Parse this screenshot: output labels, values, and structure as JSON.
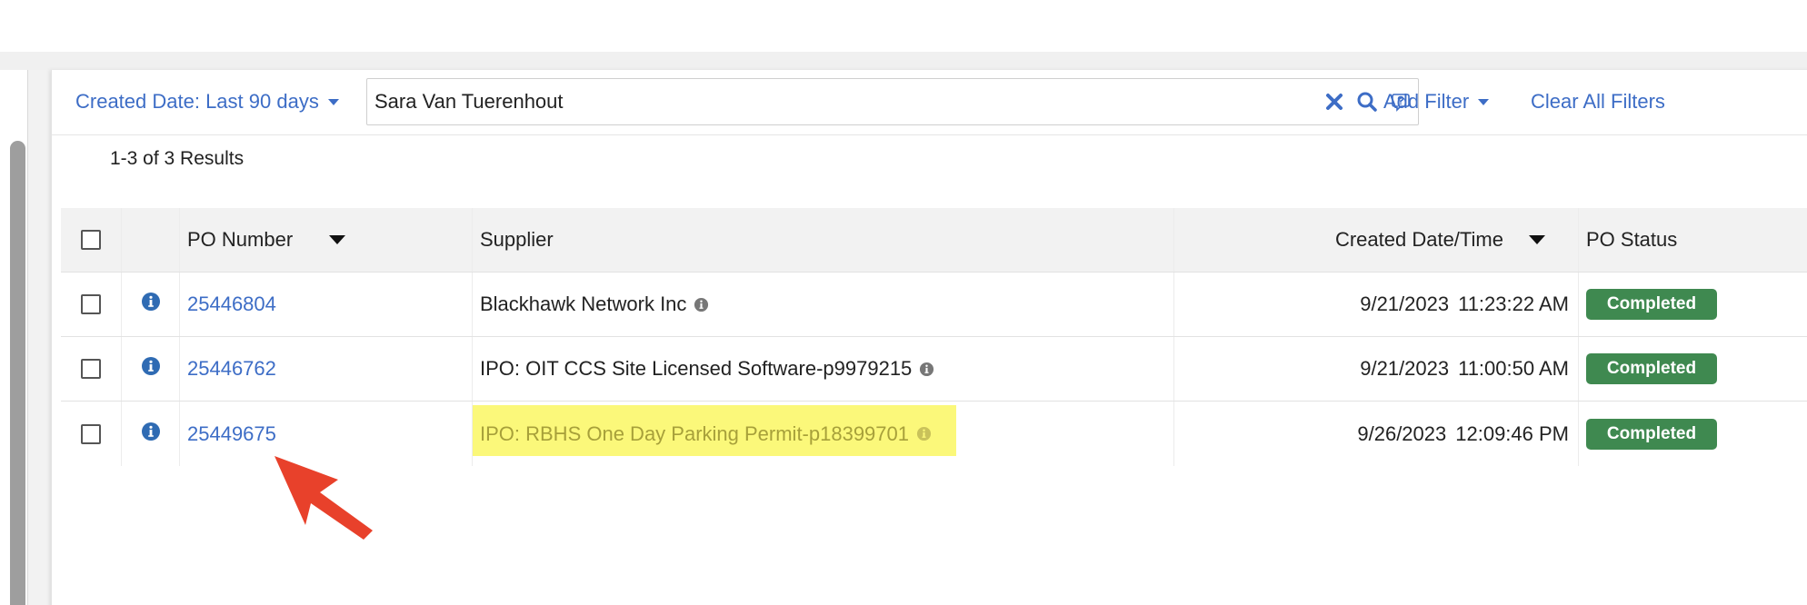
{
  "filters": {
    "date_filter_label": "Created Date: Last 90 days",
    "search_value": "Sara Van Tuerenhout",
    "add_filter_label": "Add Filter",
    "clear_filters_label": "Clear All Filters"
  },
  "results": {
    "count_label": "1-3 of 3 Results"
  },
  "table": {
    "columns": {
      "po_number": "PO Number",
      "supplier": "Supplier",
      "created": "Created Date/Time",
      "status": "PO Status"
    },
    "rows": [
      {
        "po_number": "25446804",
        "supplier": "Blackhawk Network Inc",
        "date": "9/21/2023",
        "time": "11:23:22 AM",
        "status": "Completed",
        "highlighted": false
      },
      {
        "po_number": "25446762",
        "supplier": "IPO: OIT CCS Site Licensed Software-p9979215",
        "date": "9/21/2023",
        "time": "11:00:50 AM",
        "status": "Completed",
        "highlighted": false
      },
      {
        "po_number": "25449675",
        "supplier": "IPO: RBHS One Day Parking Permit-p18399701",
        "date": "9/26/2023",
        "time": "12:09:46 PM",
        "status": "Completed",
        "highlighted": true
      }
    ]
  },
  "colors": {
    "link": "#3d6dc6",
    "status_completed": "#3f8950",
    "highlight": "#fbf87a",
    "annotation_arrow": "#e8412b"
  },
  "icons": {
    "clear_search": "close-icon",
    "search": "search-icon",
    "help": "help-icon",
    "row_info": "info-circle-icon",
    "supplier_info": "info-circle-small-icon",
    "sort": "sort-down-icon"
  }
}
